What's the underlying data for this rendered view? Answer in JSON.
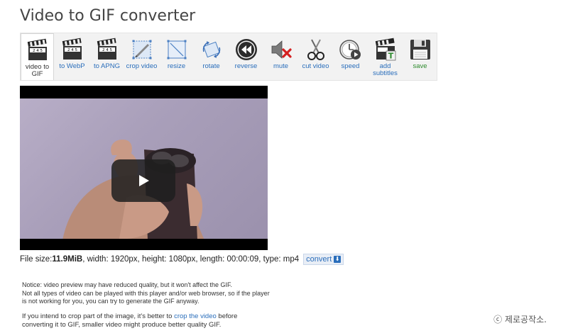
{
  "page": {
    "title": "Video to GIF converter"
  },
  "toolbar": {
    "tools": [
      {
        "label": "video to GIF",
        "icon": "clapperboard-icon",
        "active": true
      },
      {
        "label": "to WebP",
        "icon": "clapperboard-icon"
      },
      {
        "label": "to APNG",
        "icon": "clapperboard-icon"
      },
      {
        "label": "crop video",
        "icon": "crop-icon"
      },
      {
        "label": "resize",
        "icon": "resize-icon"
      },
      {
        "label": "rotate",
        "icon": "rotate-icon"
      },
      {
        "label": "reverse",
        "icon": "rewind-icon"
      },
      {
        "label": "mute",
        "icon": "mute-icon"
      },
      {
        "label": "cut video",
        "icon": "scissors-icon"
      },
      {
        "label": "speed",
        "icon": "speed-icon"
      },
      {
        "label": "add subtitles",
        "icon": "subtitles-icon"
      },
      {
        "label": "save",
        "icon": "floppy-disk-icon"
      }
    ]
  },
  "video": {
    "play_icon": "play-icon"
  },
  "file_info": {
    "size_label": "File size: ",
    "size_value": "11.9MiB",
    "details": ", width: 1920px, height: 1080px, length: 00:00:09, type: mp4",
    "convert_label": "convert"
  },
  "notice": {
    "line1": "Notice: video preview may have reduced quality, but it won't affect the GIF.",
    "line2": "Not all types of video can be played with this player and/or web browser, so if the player",
    "line3": "is not working for you, you can try to generate the GIF anyway."
  },
  "tip": {
    "before": "If you intend to crop part of the image, it's better to ",
    "link": "crop the video",
    "after": " before",
    "line2": "converting it to GIF, smaller video might produce better quality GIF."
  },
  "watermark": "ⓒ 제로공작소."
}
